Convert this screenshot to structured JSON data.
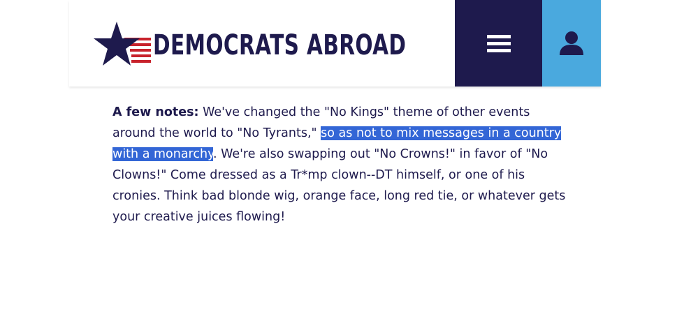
{
  "header": {
    "logo_text": "DEMOCRATS ABROAD",
    "menu_icon": "hamburger-icon",
    "user_icon": "user-icon"
  },
  "colors": {
    "navy": "#1e1a4d",
    "light_blue": "#4aa9de",
    "stripe_red": "#c8232c",
    "selection": "#3366d6"
  },
  "content": {
    "lead": "A few notes:",
    "text_1": " We've changed the \"No Kings\" theme of other events around the world to \"No Tyrants,\" ",
    "text_selected": "so as not to mix messages in a country with a monarchy",
    "text_2": ". We're also swapping out \"No Crowns!\" in favor of \"No Clowns!\" Come dressed as a Tr*mp clown--DT himself, or one of his cronies. Think bad blonde wig, orange face, long red tie, or whatever gets your creative juices flowing!"
  }
}
